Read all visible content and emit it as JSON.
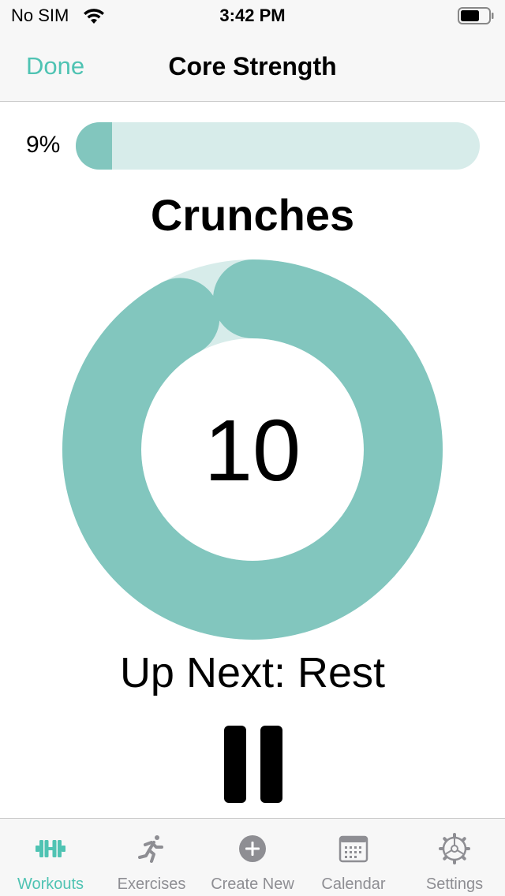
{
  "status_bar": {
    "carrier": "No SIM",
    "time": "3:42 PM"
  },
  "nav": {
    "done_label": "Done",
    "title": "Core Strength"
  },
  "progress": {
    "label": "9%",
    "fraction": 0.09
  },
  "exercise": {
    "name": "Crunches",
    "count": "10",
    "ring_fraction": 0.92
  },
  "up_next": "Up Next: Rest",
  "colors": {
    "accent": "#4fc3b3",
    "ring_fill": "#82c6be",
    "ring_track": "#d7ecea",
    "inactive": "#8e8e93"
  },
  "tabs": [
    {
      "label": "Workouts",
      "icon": "dumbbell-icon",
      "active": true
    },
    {
      "label": "Exercises",
      "icon": "running-person-icon",
      "active": false
    },
    {
      "label": "Create New",
      "icon": "plus-circle-icon",
      "active": false
    },
    {
      "label": "Calendar",
      "icon": "calendar-icon",
      "active": false
    },
    {
      "label": "Settings",
      "icon": "gear-icon",
      "active": false
    }
  ]
}
